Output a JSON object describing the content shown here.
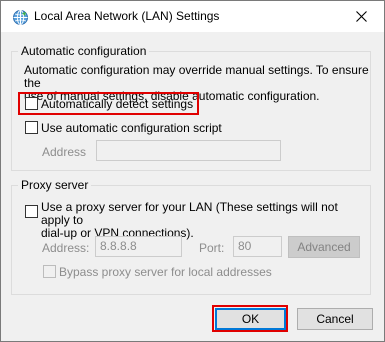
{
  "window": {
    "title": "Local Area Network (LAN) Settings"
  },
  "auto_config": {
    "group_label": "Automatic configuration",
    "description": "Automatic configuration may override manual settings.  To ensure the use of manual settings, disable automatic configuration.",
    "description_line1": "Automatic configuration may override manual settings.  To ensure the",
    "description_line2": "use of manual settings, disable automatic configuration.",
    "detect_settings_label": "Automatically detect settings",
    "detect_settings_checked": false,
    "use_script_label": "Use automatic configuration script",
    "use_script_checked": false,
    "address_label": "Address",
    "address_value": ""
  },
  "proxy": {
    "group_label": "Proxy server",
    "use_proxy_label": "Use a proxy server for your LAN (These settings will not apply to dial-up or VPN connections).",
    "use_proxy_line1": "Use a proxy server for your LAN (These settings will not apply to",
    "use_proxy_line2": "dial-up or VPN connections).",
    "use_proxy_checked": false,
    "address_label": "Address:",
    "address_value": "8.8.8.8",
    "port_label": "Port:",
    "port_value": "80",
    "advanced_label": "Advanced",
    "bypass_label": "Bypass proxy server for local addresses",
    "bypass_checked": false
  },
  "buttons": {
    "ok_label": "OK",
    "cancel_label": "Cancel"
  },
  "colors": {
    "highlight": "#e00000",
    "accent": "#0078d7"
  }
}
